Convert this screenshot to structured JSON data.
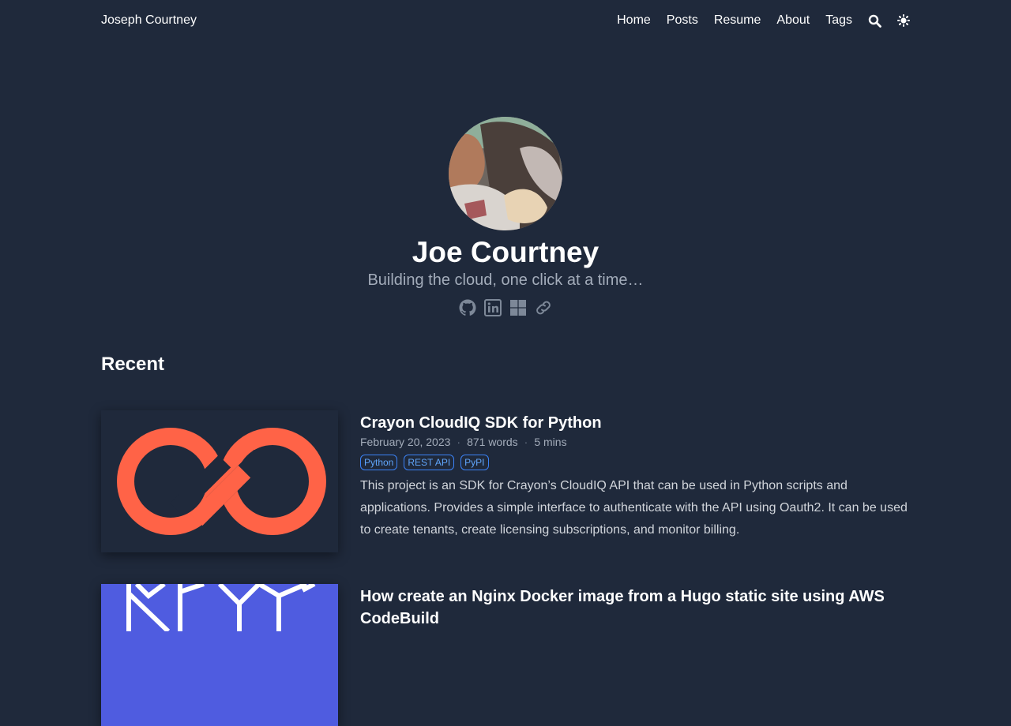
{
  "header": {
    "brand": "Joseph Courtney",
    "nav": [
      "Home",
      "Posts",
      "Resume",
      "About",
      "Tags"
    ],
    "search_icon": "search-icon",
    "theme_icon": "sun-icon"
  },
  "profile": {
    "name": "Joe Courtney",
    "tagline": "Building the cloud, one click at a time…",
    "socials": [
      "github-icon",
      "linkedin-icon",
      "microsoft-icon",
      "link-icon"
    ]
  },
  "recent": {
    "title": "Recent",
    "posts": [
      {
        "title": "Crayon CloudIQ SDK for Python",
        "date": "February 20, 2023",
        "words": "871 words",
        "read_time": "5 mins",
        "tags": [
          "Python",
          "REST API",
          "PyPI"
        ],
        "summary": "This project is an SDK for Crayon’s CloudIQ API that can be used in Python scripts and applications. Provides a simple interface to authenticate with the API using Oauth2. It can be used to create tenants, create licensing subscriptions, and monitor billing."
      },
      {
        "title": "How create an Nginx Docker image from a Hugo static site using AWS CodeBuild"
      }
    ]
  },
  "colors": {
    "background": "#1f293b",
    "accent": "#ff6347",
    "tag": "#60a5fa"
  }
}
